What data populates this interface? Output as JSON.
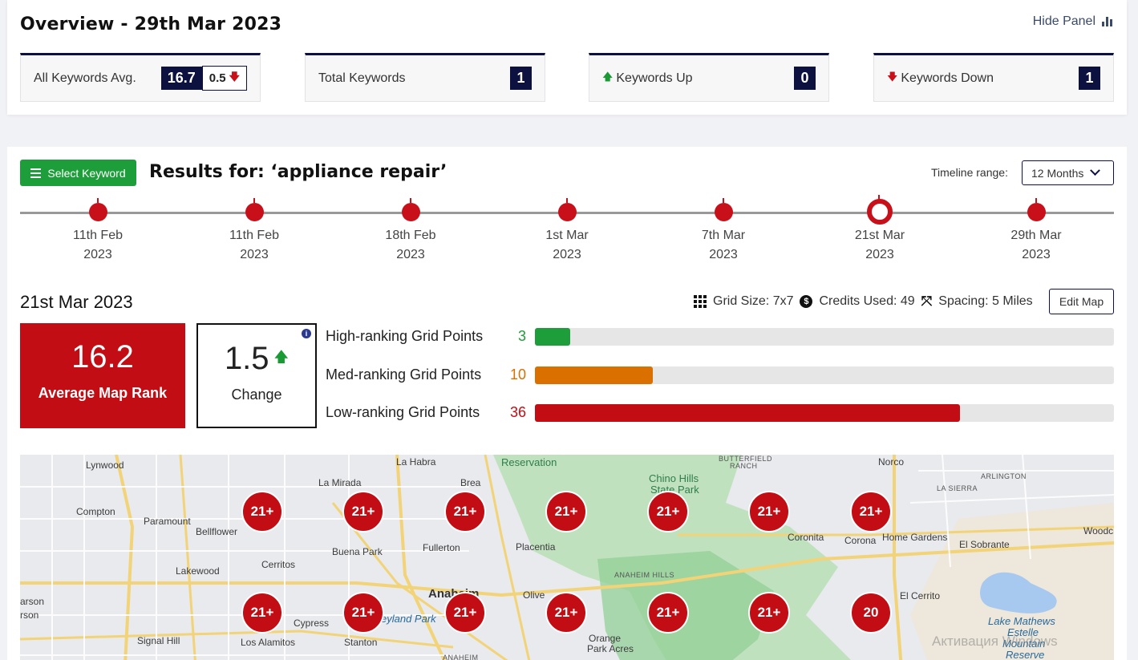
{
  "overview": {
    "title": "Overview - 29th Mar 2023",
    "hide_panel": "Hide Panel",
    "cards": {
      "avg": {
        "label": "All Keywords Avg.",
        "value": "16.7",
        "delta": "0.5"
      },
      "total": {
        "label": "Total Keywords",
        "value": "1"
      },
      "up": {
        "label": "Keywords Up",
        "value": "0"
      },
      "down": {
        "label": "Keywords Down",
        "value": "1"
      }
    }
  },
  "results": {
    "select_keyword": "Select Keyword",
    "title": "Results for: ‘appliance repair’",
    "timeline_label": "Timeline range:",
    "timeline_value": "12 Months",
    "timeline": [
      {
        "day": "11th Feb",
        "year": "2023"
      },
      {
        "day": "11th Feb",
        "year": "2023"
      },
      {
        "day": "18th Feb",
        "year": "2023"
      },
      {
        "day": "1st Mar",
        "year": "2023"
      },
      {
        "day": "7th Mar",
        "year": "2023"
      },
      {
        "day": "21st Mar",
        "year": "2023",
        "active": true
      },
      {
        "day": "29th Mar",
        "year": "2023"
      }
    ],
    "date_heading": "21st Mar 2023",
    "grid_size": "Grid Size: 7x7",
    "credits": "Credits Used: 49",
    "spacing": "Spacing: 5 Miles",
    "edit_map": "Edit Map",
    "avg_rank": {
      "value": "16.2",
      "label": "Average Map Rank"
    },
    "change": {
      "value": "1.5",
      "label": "Change"
    },
    "grid_points": [
      {
        "label": "High-ranking Grid Points",
        "value": "3",
        "count": 3,
        "color": "#1e9e3a"
      },
      {
        "label": "Med-ranking Grid Points",
        "value": "10",
        "count": 10,
        "color": "#d97000"
      },
      {
        "label": "Low-ranking Grid Points",
        "value": "36",
        "count": 36,
        "color": "#c20d14"
      }
    ],
    "grid_total": 49
  },
  "map": {
    "pins_row1": [
      "21+",
      "21+",
      "21+",
      "21+",
      "21+",
      "21+",
      "21+"
    ],
    "pins_row2": [
      "21+",
      "21+",
      "21+",
      "21+",
      "21+",
      "21+",
      "20"
    ],
    "labels": {
      "lynwood": "Lynwood",
      "la_habra": "La Habra",
      "reservation": "Reservation",
      "butterfield": "BUTTERFIELD",
      "ranch": "RANCH",
      "norco": "Norco",
      "la_mirada": "La Mirada",
      "brea": "Brea",
      "chino_hills": "Chino Hills",
      "state_park": "State Park",
      "arlington": "ARLINGTON",
      "la_sierra": "LA SIERRA",
      "compton": "Compton",
      "paramount": "Paramount",
      "bellflower": "Bellflower",
      "woodcr": "Woodcr",
      "buena_park": "Buena Park",
      "fullerton": "Fullerton",
      "placentia": "Placentia",
      "coronita": "Coronita",
      "corona": "Corona",
      "home_gardens": "Home Gardens",
      "el_sobrante": "El Sobrante",
      "cerritos": "Cerritos",
      "lakewood": "Lakewood",
      "anaheim_hills": "ANAHEIM HILLS",
      "anaheim": "Anaheim",
      "olive": "Olive",
      "el_cerrito": "El Cerrito",
      "arson": "arson",
      "rson": "rson",
      "cypress": "Cypress",
      "eyland_park": "eyland Park",
      "lake_mathews": "Lake Mathews",
      "estelle": "Estelle",
      "mountain": "Mountain",
      "reserve": "Reserve",
      "signal_hill": "Signal Hill",
      "los_alamitos": "Los Alamitos",
      "stanton": "Stanton",
      "orange": "Orange",
      "park_acres": "Park Acres",
      "anaheim_sm": "ANAHEIM"
    },
    "watermark": "Активация Windows"
  }
}
